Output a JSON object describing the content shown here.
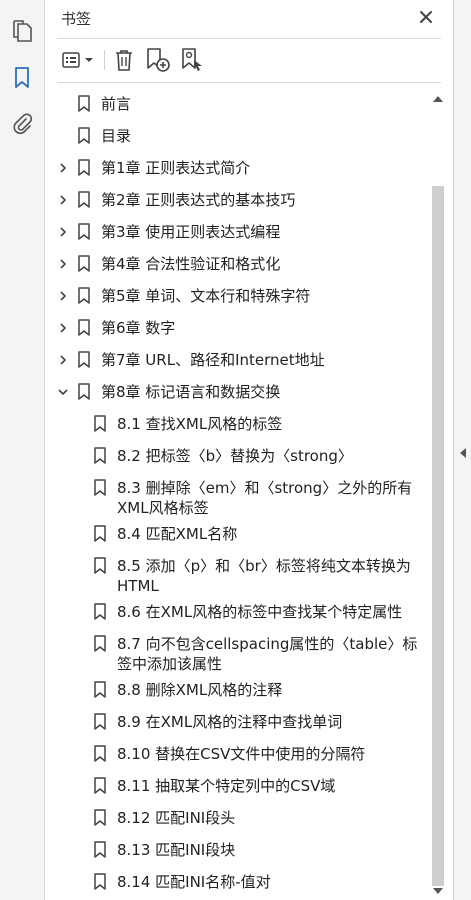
{
  "panel": {
    "title": "书签",
    "close_icon": "close-icon"
  },
  "left_rail": {
    "icons": [
      "pages-icon",
      "bookmark-icon",
      "attachment-icon"
    ],
    "active": "bookmark-icon",
    "accent_color": "#2d6fb8"
  },
  "toolbar": {
    "icons": [
      "options-menu-icon",
      "delete-icon",
      "new-bookmark-icon",
      "new-bookmark-from-structure-icon"
    ]
  },
  "bookmarks": [
    {
      "label": "前言",
      "level": 0,
      "expandable": false,
      "expanded": false
    },
    {
      "label": "目录",
      "level": 0,
      "expandable": false,
      "expanded": false
    },
    {
      "label": "第1章 正则表达式简介",
      "level": 0,
      "expandable": true,
      "expanded": false
    },
    {
      "label": "第2章 正则表达式的基本技巧",
      "level": 0,
      "expandable": true,
      "expanded": false
    },
    {
      "label": "第3章 使用正则表达式编程",
      "level": 0,
      "expandable": true,
      "expanded": false
    },
    {
      "label": "第4章 合法性验证和格式化",
      "level": 0,
      "expandable": true,
      "expanded": false
    },
    {
      "label": "第5章 单词、文本行和特殊字符",
      "level": 0,
      "expandable": true,
      "expanded": false
    },
    {
      "label": "第6章 数字",
      "level": 0,
      "expandable": true,
      "expanded": false
    },
    {
      "label": "第7章 URL、路径和Internet地址",
      "level": 0,
      "expandable": true,
      "expanded": false
    },
    {
      "label": "第8章 标记语言和数据交换",
      "level": 0,
      "expandable": true,
      "expanded": true
    },
    {
      "label": "8.1 查找XML风格的标签",
      "level": 1,
      "expandable": false,
      "expanded": false
    },
    {
      "label": "8.2 把标签〈b〉替换为〈strong〉",
      "level": 1,
      "expandable": false,
      "expanded": false
    },
    {
      "label": "8.3 删掉除〈em〉和〈strong〉之外的所有XML风格标签",
      "level": 1,
      "expandable": false,
      "expanded": false
    },
    {
      "label": "8.4 匹配XML名称",
      "level": 1,
      "expandable": false,
      "expanded": false
    },
    {
      "label": "8.5 添加〈p〉和〈br〉标签将纯文本转换为HTML",
      "level": 1,
      "expandable": false,
      "expanded": false
    },
    {
      "label": "8.6 在XML风格的标签中查找某个特定属性",
      "level": 1,
      "expandable": false,
      "expanded": false
    },
    {
      "label": "8.7 向不包含cellspacing属性的〈table〉标签中添加该属性",
      "level": 1,
      "expandable": false,
      "expanded": false
    },
    {
      "label": "8.8 删除XML风格的注释",
      "level": 1,
      "expandable": false,
      "expanded": false
    },
    {
      "label": "8.9 在XML风格的注释中查找单词",
      "level": 1,
      "expandable": false,
      "expanded": false
    },
    {
      "label": "8.10 替换在CSV文件中使用的分隔符",
      "level": 1,
      "expandable": false,
      "expanded": false
    },
    {
      "label": "8.11 抽取某个特定列中的CSV域",
      "level": 1,
      "expandable": false,
      "expanded": false
    },
    {
      "label": "8.12 匹配INI段头",
      "level": 1,
      "expandable": false,
      "expanded": false
    },
    {
      "label": "8.13 匹配INI段块",
      "level": 1,
      "expandable": false,
      "expanded": false
    },
    {
      "label": "8.14 匹配INI名称-值对",
      "level": 1,
      "expandable": false,
      "expanded": false
    }
  ]
}
